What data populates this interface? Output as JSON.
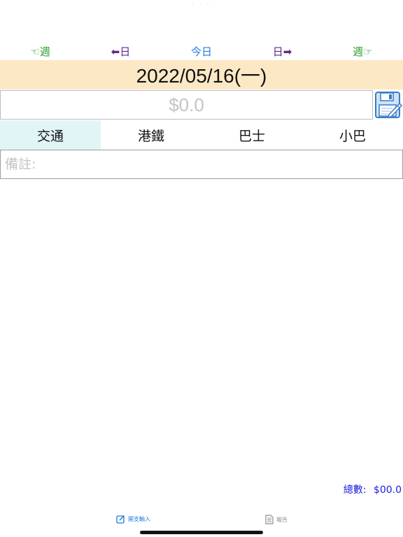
{
  "status_bar": {
    "dots": "· · ·"
  },
  "nav": {
    "prev_week": "☜週",
    "prev_day": "⬅日",
    "today": "今日",
    "next_day": "日➡",
    "next_week": "週☞"
  },
  "date": "2022/05/16(一)",
  "amount": {
    "value": "",
    "placeholder": "$0.0"
  },
  "categories": [
    "交通",
    "港鐵",
    "巴士",
    "小巴"
  ],
  "selected_category": "交通",
  "note": {
    "value": "",
    "placeholder": "備註:"
  },
  "total": {
    "label": "總數:",
    "value": "$00.0"
  },
  "tabbar": {
    "input_label": "開支輸入",
    "report_label": "報告"
  },
  "colors": {
    "nav_week": "#2a9d2a",
    "nav_day": "#5b2a8a",
    "nav_today": "#1e7be0",
    "date_bar_bg": "#fde8c6",
    "active_tab_bg": "#e1f5f7",
    "total_text": "#1a1adf"
  },
  "icons": {
    "save": "save-floppy-icon",
    "input_tab": "compose-icon",
    "report_tab": "document-icon"
  }
}
